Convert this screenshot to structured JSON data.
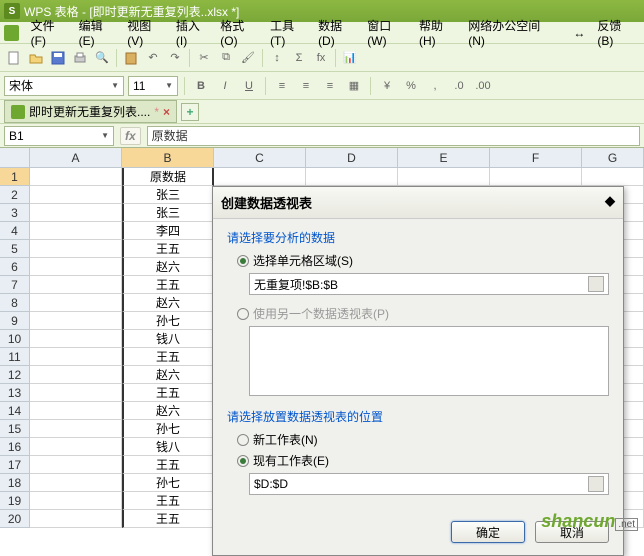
{
  "title": "WPS 表格 - [即时更新无重复列表..xlsx *]",
  "menus": [
    "文件(F)",
    "编辑(E)",
    "视图(V)",
    "插入(I)",
    "格式(O)",
    "工具(T)",
    "数据(D)",
    "窗口(W)",
    "帮助(H)",
    "网络办公空间(N)"
  ],
  "feedback": "反馈(B)",
  "font": "宋体",
  "fontsize": "11",
  "doctab": "即时更新无重复列表....",
  "namebox": "B1",
  "formula": "原数据",
  "columns": [
    "A",
    "B",
    "C",
    "D",
    "E",
    "F",
    "G"
  ],
  "rows_count": 20,
  "colB_header": "原数据",
  "colB_values": [
    "张三",
    "张三",
    "李四",
    "王五",
    "赵六",
    "王五",
    "赵六",
    "孙七",
    "钱八",
    "王五",
    "赵六",
    "王五",
    "赵六",
    "孙七",
    "钱八",
    "王五",
    "孙七",
    "王五",
    "王五"
  ],
  "dialog": {
    "title": "创建数据透视表",
    "section1": "请选择要分析的数据",
    "opt_range": "选择单元格区域(S)",
    "range_value": "无重复项!$B:$B",
    "opt_pivot": "使用另一个数据透视表(P)",
    "section2": "请选择放置数据透视表的位置",
    "opt_new": "新工作表(N)",
    "opt_exist": "现有工作表(E)",
    "location_value": "$D:$D",
    "ok": "确定",
    "cancel": "取消"
  },
  "watermark": "shancun",
  "watermark2": ".net"
}
